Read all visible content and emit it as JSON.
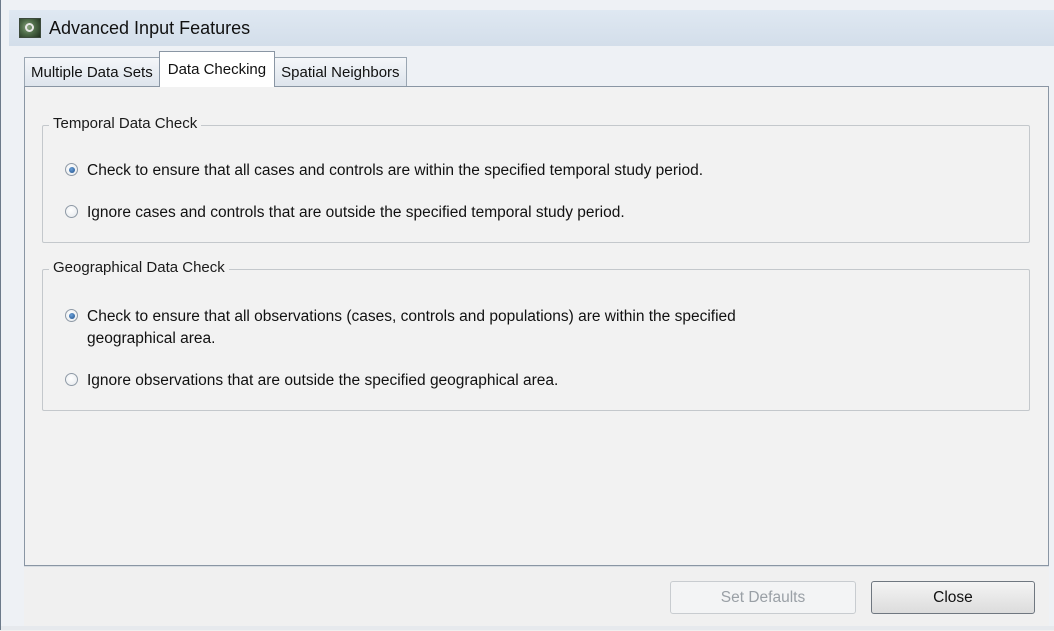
{
  "window": {
    "title": "Advanced Input Features"
  },
  "tabs": [
    {
      "label": "Multiple Data Sets",
      "active": false
    },
    {
      "label": "Data Checking",
      "active": true
    },
    {
      "label": "Spatial Neighbors",
      "active": false
    }
  ],
  "temporal": {
    "label": "Temporal Data Check",
    "options": [
      {
        "label": "Check to ensure that all cases and controls are within the specified temporal study period.",
        "selected": true
      },
      {
        "label": "Ignore cases and controls that are outside the specified temporal study period.",
        "selected": false
      }
    ]
  },
  "geographical": {
    "label": "Geographical Data Check",
    "options": [
      {
        "label_line1": "Check to ensure that all observations (cases, controls and populations) are within the specified",
        "label_line2": "geographical area.",
        "selected": true
      },
      {
        "label": "Ignore observations that are outside the specified geographical area.",
        "selected": false
      }
    ]
  },
  "buttons": {
    "set_defaults": {
      "label": "Set Defaults",
      "enabled": false
    },
    "close": {
      "label": "Close",
      "enabled": true
    }
  },
  "icons": {
    "app": "app-icon",
    "radio": "radio-button"
  }
}
